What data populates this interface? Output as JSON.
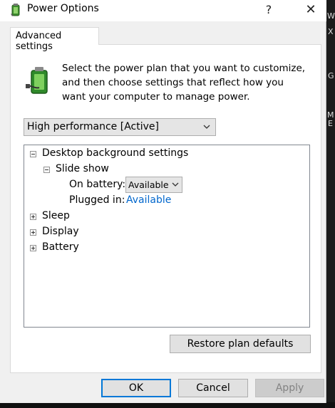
{
  "window": {
    "title": "Power Options",
    "help_label": "?",
    "close_label": "✕"
  },
  "background": {
    "edge_chars": [
      "W",
      "X",
      "G",
      "M",
      "E"
    ]
  },
  "tab": {
    "label": "Advanced settings"
  },
  "description": "Select the power plan that you want to customize, and then choose settings that reflect how you want your computer to manage power.",
  "plan_select": {
    "value": "High performance [Active]"
  },
  "tree": {
    "desktop_background": {
      "label": "Desktop background settings",
      "expanded": true
    },
    "slide_show": {
      "label": "Slide show",
      "expanded": true
    },
    "on_battery": {
      "label": "On battery:",
      "value": "Available"
    },
    "plugged_in": {
      "label": "Plugged in:",
      "value": "Available"
    },
    "sleep": {
      "label": "Sleep",
      "expanded": false
    },
    "display": {
      "label": "Display",
      "expanded": false
    },
    "battery": {
      "label": "Battery",
      "expanded": false
    }
  },
  "buttons": {
    "restore": "Restore plan defaults",
    "ok": "OK",
    "cancel": "Cancel",
    "apply": "Apply"
  },
  "colors": {
    "accent": "#0078d7",
    "link": "#0066cc",
    "dialog_bg": "#f0f0f0",
    "panel_bg": "#ffffff"
  }
}
